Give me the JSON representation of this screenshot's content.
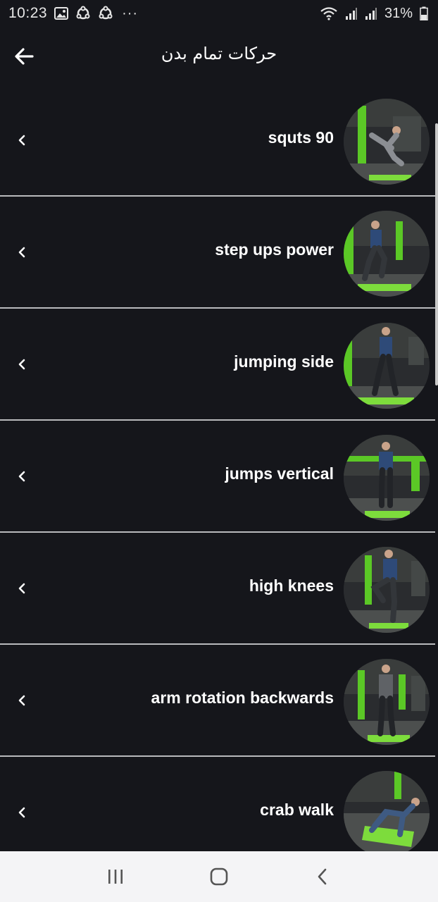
{
  "status_bar": {
    "time": "10:23",
    "dots": "···",
    "battery_percent": "31%",
    "icons": [
      "gallery-icon",
      "sync-icon",
      "sync-icon",
      "wifi-icon",
      "signal-icon",
      "signal-icon",
      "battery-icon"
    ]
  },
  "app_bar": {
    "title": "حرکات تمام بدن",
    "back_icon": "arrow-left-icon"
  },
  "exercises": [
    {
      "label": "squts 90"
    },
    {
      "label": "step ups power"
    },
    {
      "label": "jumping side"
    },
    {
      "label": "jumps vertical"
    },
    {
      "label": "high knees"
    },
    {
      "label": "arm rotation backwards"
    },
    {
      "label": "crab walk"
    }
  ],
  "nav_bar": {
    "icons": [
      "recent-apps-icon",
      "home-icon",
      "back-icon"
    ]
  },
  "colors": {
    "background": "#15161b",
    "divider": "#b9babd",
    "accent_green": "#7ddc3c",
    "nav_background": "#f4f4f6"
  }
}
